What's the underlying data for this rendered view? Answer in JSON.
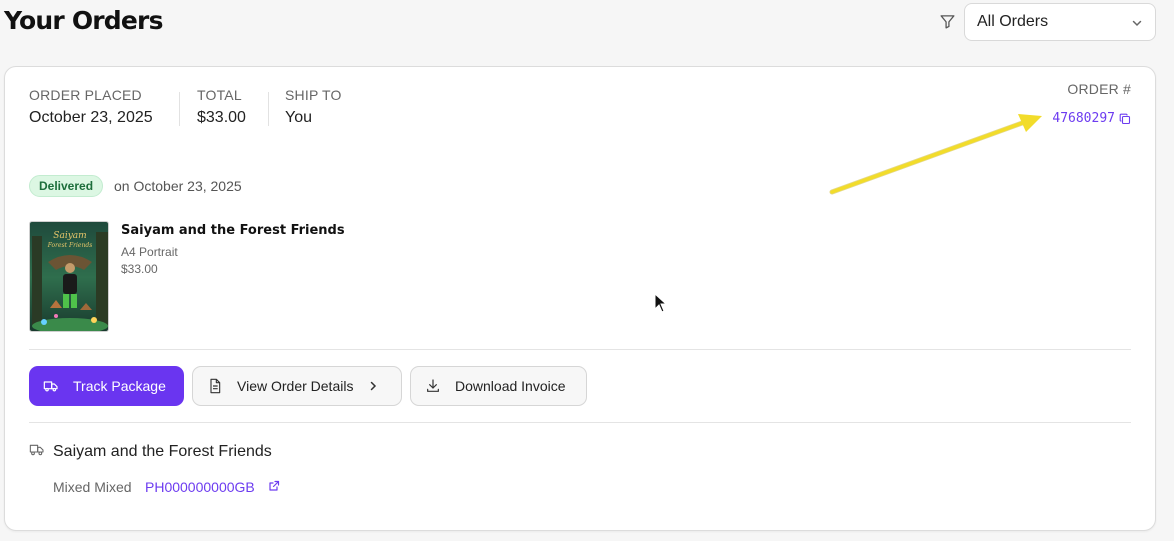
{
  "header": {
    "title": "Your Orders",
    "filter_icon": "filter-icon",
    "filter_select": {
      "selected": "All Orders",
      "icon": "chevron-down-icon"
    }
  },
  "order": {
    "placed_label": "ORDER PLACED",
    "placed_value": "October 23, 2025",
    "total_label": "TOTAL",
    "total_value": "$33.00",
    "ship_to_label": "SHIP TO",
    "ship_to_value": "You",
    "number_label": "ORDER #",
    "number_value": "47680297",
    "copy_icon": "copy-icon",
    "status": {
      "badge": "Delivered",
      "date_text": "on October 23, 2025",
      "color": "#1d6e3b"
    },
    "item": {
      "title": "Saiyam and the Forest Friends",
      "variant": "A4 Portrait",
      "price": "$33.00"
    },
    "actions": {
      "track": {
        "label": "Track Package",
        "icon": "truck-icon"
      },
      "details": {
        "label": "View Order Details",
        "icon": "document-icon"
      },
      "invoice": {
        "label": "Download Invoice",
        "icon": "download-icon"
      }
    },
    "shipment": {
      "title": "Saiyam and the Forest Friends",
      "carrier": "Mixed Mixed",
      "tracking": "PH000000000GB",
      "icon": "truck-icon"
    }
  },
  "colors": {
    "accent": "#6a35f0",
    "link": "#6d3cf0",
    "annotation_arrow": "#f2dc2a"
  }
}
